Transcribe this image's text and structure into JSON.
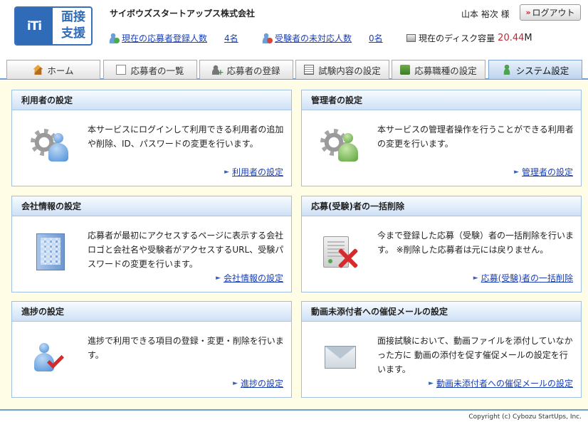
{
  "header": {
    "logo_mark": "iTi",
    "logo_text": "面接 支援",
    "company": "サイボウズスタートアップス株式会社",
    "user": "山本 裕次 様",
    "logout_label": "ログアウト",
    "logout_icon": "double-chevron-right-icon",
    "stats": {
      "applicants_link": "現在の応募者登録人数",
      "applicants_count": "4名",
      "unhandled_link": "受験者の未対応人数",
      "unhandled_count": "0名",
      "disk_label": "現在のディスク容量",
      "disk_value": "20.44",
      "disk_unit": "M"
    }
  },
  "tabs": [
    {
      "label": "ホーム",
      "icon": "home-icon",
      "active": false
    },
    {
      "label": "応募者の一覧",
      "icon": "list-icon",
      "active": false
    },
    {
      "label": "応募者の登録",
      "icon": "person-add-icon",
      "active": false
    },
    {
      "label": "試験内容の設定",
      "icon": "clipboard-icon",
      "active": false
    },
    {
      "label": "応募職種の設定",
      "icon": "box-icon",
      "active": false
    },
    {
      "label": "システム設定",
      "icon": "person-icon",
      "active": true
    }
  ],
  "cards": {
    "users": {
      "title": "利用者の設定",
      "text": "本サービスにログインして利用できる利用者の追加や削除、ID、パスワードの変更を行います。",
      "link": "利用者の設定",
      "icon": "gear-user-icon"
    },
    "admins": {
      "title": "管理者の設定",
      "text": "本サービスの管理者操作を行うことができる利用者の変更を行います。",
      "link": "管理者の設定",
      "icon": "gear-admin-icon"
    },
    "company": {
      "title": "会社情報の設定",
      "text": "応募者が最初にアクセスするページに表示する会社ロゴと会社名や受験者がアクセスするURL、受験パスワードの変更を行います。",
      "link": "会社情報の設定",
      "icon": "building-icon"
    },
    "bulk_delete": {
      "title": "応募(受験)者の一括削除",
      "text": "今まで登録した応募（受験）者の一括削除を行います。 ※削除した応募者は元には戻りません。",
      "link": "応募(受験)者の一括削除",
      "icon": "delete-server-icon"
    },
    "progress": {
      "title": "進捗の設定",
      "text": "進捗で利用できる項目の登録・変更・削除を行います。",
      "link": "進捗の設定",
      "icon": "user-check-icon"
    },
    "reminder": {
      "title": "動画未添付者への催促メールの設定",
      "text": "面接試験において、動画ファイルを添付していなかった方に 動画の添付を促す催促メールの設定を行います。",
      "link": "動画未添付者への催促メールの設定",
      "icon": "mail-icon"
    }
  },
  "footer": {
    "copyright": "Copyright (c) Cybozu StartUps, Inc."
  },
  "colors": {
    "accent": "#2f6bb7",
    "panel_bg": "#fffde6",
    "link": "#1a3fb5",
    "alert": "#c3262f"
  }
}
